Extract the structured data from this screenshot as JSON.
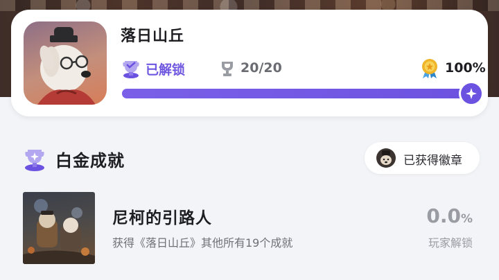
{
  "game": {
    "title": "落日山丘",
    "status_label": "已解锁",
    "trophy_count": "20/20",
    "completion_text": "100%",
    "completion": 1.0
  },
  "section": {
    "title": "白金成就",
    "badge_button_label": "已获得徽章"
  },
  "achievement": {
    "name": "尼柯的引路人",
    "description": "获得《落日山丘》其他所有19个成就",
    "rate_value": "0.0",
    "rate_unit": "%",
    "rate_label": "玩家解锁"
  },
  "colors": {
    "accent": "#6c52e0",
    "track": "#e4e1f4",
    "muted": "#9a9ca3"
  }
}
